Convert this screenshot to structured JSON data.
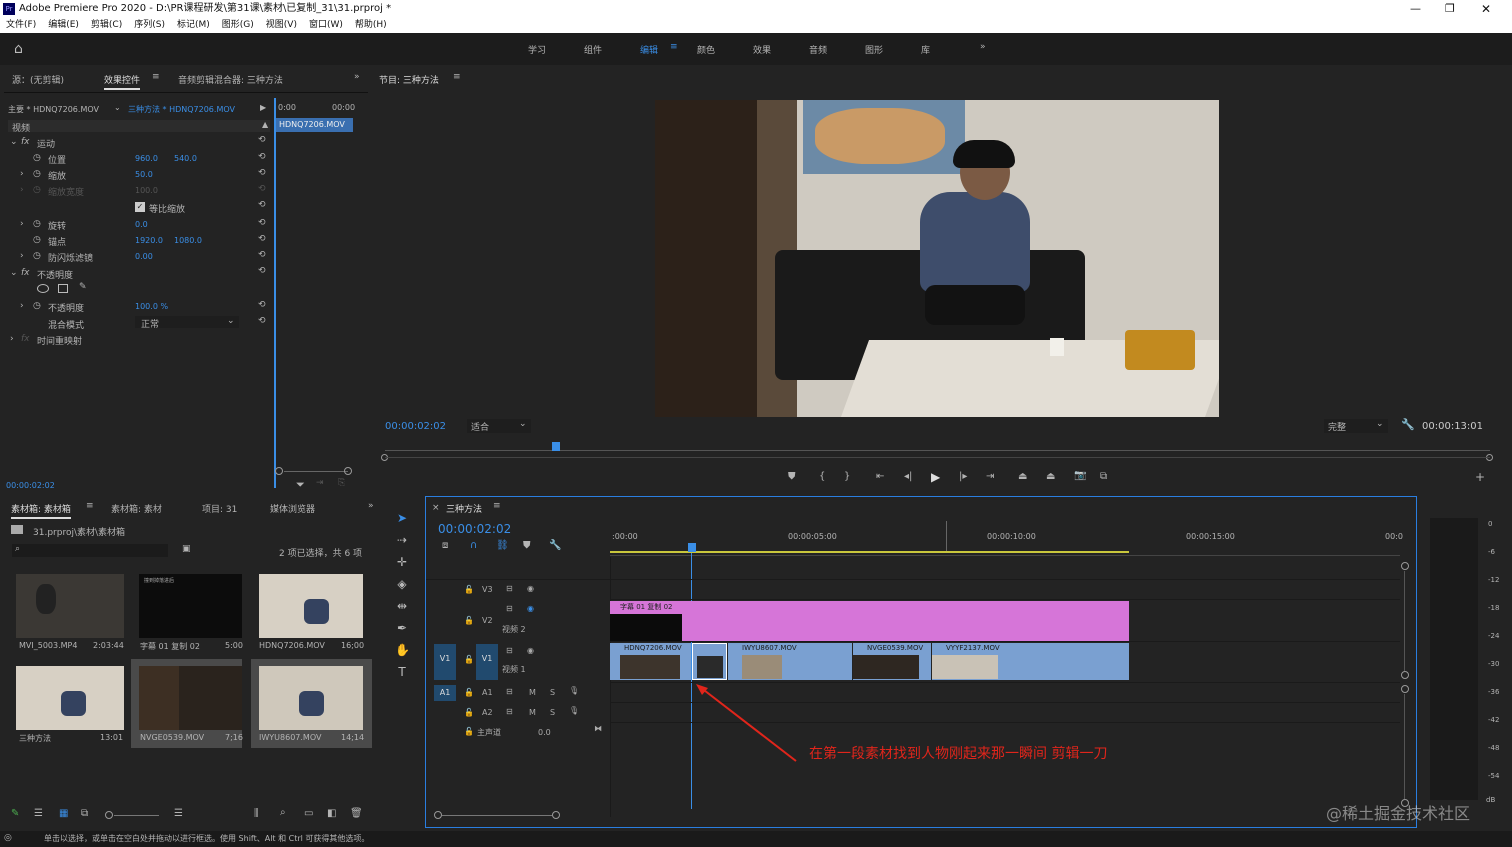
{
  "app": {
    "icon": "Pr",
    "title": "Adobe Premiere Pro 2020 - D:\\PR课程研发\\第31课\\素材\\已复制_31\\31.prproj *"
  },
  "menu": [
    "文件(F)",
    "编辑(E)",
    "剪辑(C)",
    "序列(S)",
    "标记(M)",
    "图形(G)",
    "视图(V)",
    "窗口(W)",
    "帮助(H)"
  ],
  "workspaces": [
    "学习",
    "组件",
    "编辑",
    "颜色",
    "效果",
    "音频",
    "图形",
    "库"
  ],
  "active_workspace": "编辑",
  "effect_panel": {
    "tabs": [
      "源：(无剪辑)",
      "效果控件",
      "音频剪辑混合器: 三种方法"
    ],
    "master": "主要 * HDNQ7206.MOV",
    "seq": "三种方法 * HDNQ7206.MOV",
    "t0": "0:00",
    "t1": "00:00",
    "clip_label": "HDNQ7206.MOV",
    "section_video": "视频",
    "motion": "运动",
    "pos": "位置",
    "pos_x": "960.0",
    "pos_y": "540.0",
    "scale": "缩放",
    "scale_v": "50.0",
    "scale_w": "缩放宽度",
    "scale_w_v": "100.0",
    "uniform": "等比缩放",
    "rotate": "旋转",
    "rotate_v": "0.0",
    "anchor": "锚点",
    "anchor_x": "1920.0",
    "anchor_y": "1080.0",
    "antiflicker": "防闪烁滤镜",
    "antiflicker_v": "0.00",
    "opacity": "不透明度",
    "opacity_label": "不透明度",
    "opacity_v": "100.0 %",
    "blend": "混合模式",
    "blend_v": "正常",
    "time_remap": "时间重映射",
    "timecode": "00:00:02:02"
  },
  "program": {
    "title": "节目: 三种方法",
    "timecode": "00:00:02:02",
    "fit": "适合",
    "quality": "完整",
    "duration": "00:00:13:01"
  },
  "bins": {
    "tabs": [
      "素材箱: 素材箱",
      "素材箱: 素材",
      "项目: 31",
      "媒体浏览器"
    ],
    "path": "31.prproj\\素材\\素材箱",
    "count": "2 项已选择，共 6 项",
    "items": [
      {
        "name": "MVI_5003.MP4",
        "dur": "2:03:44"
      },
      {
        "name": "字幕 01 复制 02",
        "dur": "5:00"
      },
      {
        "name": "HDNQ7206.MOV",
        "dur": "16;00"
      },
      {
        "name": "三种方法",
        "dur": "13:01"
      },
      {
        "name": "NVGE0539.MOV",
        "dur": "7;16"
      },
      {
        "name": "IWYU8607.MOV",
        "dur": "14;14"
      }
    ],
    "thumb_text": "撞到掉落进后"
  },
  "timeline": {
    "title": "三种方法",
    "timecode": "00:00:02:02",
    "ruler": [
      ":00:00",
      "00:00:05:00",
      "00:00:10:00",
      "00:00:15:00",
      "00:0"
    ],
    "tracks": {
      "v3": "V3",
      "v2": "V2",
      "v2name": "视频 2",
      "v1": "V1",
      "v1name": "视频 1",
      "a1": "A1",
      "a2": "A2",
      "master": "主声道",
      "master_v": "0.0",
      "m": "M",
      "s": "S"
    },
    "clips": {
      "title": "字幕 01 复制 02",
      "c1": "HDNQ7206.MOV",
      "c3": "IWYU8607.MOV",
      "c4": "NVGE0539.MOV",
      "c5": "VYYF2137.MOV"
    },
    "annotation": "在第一段素材找到人物刚起来那一瞬间 剪辑一刀"
  },
  "meter": [
    "0",
    "-6",
    "-12",
    "-18",
    "-24",
    "-30",
    "-36",
    "-42",
    "-48",
    "-54",
    "dB"
  ],
  "status": "单击以选择，或单击在空白处并拖动以进行框选。使用 Shift、Alt 和 Ctrl 可获得其他选项。",
  "watermark": "@稀土掘金技术社区"
}
